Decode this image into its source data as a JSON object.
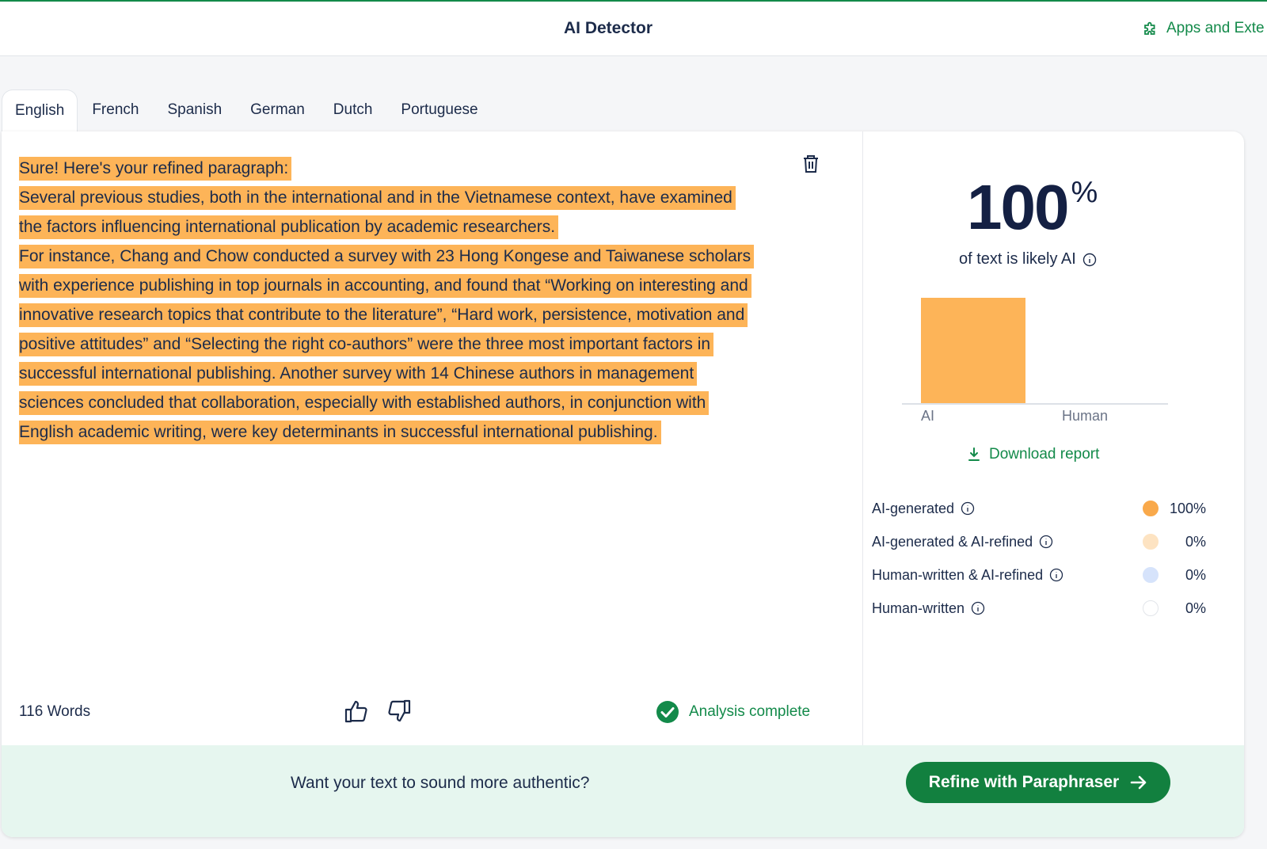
{
  "header": {
    "title": "AI Detector",
    "apps_link": "Apps and Exte"
  },
  "tabs": [
    {
      "label": "English",
      "active": true
    },
    {
      "label": "French",
      "active": false
    },
    {
      "label": "Spanish",
      "active": false
    },
    {
      "label": "German",
      "active": false
    },
    {
      "label": "Dutch",
      "active": false
    },
    {
      "label": "Portuguese",
      "active": false
    }
  ],
  "editor": {
    "lines": [
      "Sure! Here's your refined paragraph:",
      "Several previous studies, both in the international and in the Vietnamese context, have examined",
      "the factors influencing international publication by academic researchers.",
      "For instance, Chang and Chow conducted a survey with 23 Hong Kongese and Taiwanese scholars",
      "with experience publishing in top journals in accounting, and found that “Working on interesting and",
      "innovative research topics that contribute to the literature”, “Hard work, persistence, motivation and",
      "positive attitudes” and “Selecting the right co-authors” were the three most important factors in",
      "successful international publishing. Another survey with 14 Chinese authors in management",
      "sciences concluded that collaboration, especially with established authors, in conjunction with",
      "English academic writing, were key determinants in successful international publishing."
    ],
    "highlight_color": "#fdb458",
    "word_count": "116 Words",
    "status": "Analysis complete"
  },
  "results": {
    "score": "100",
    "score_unit": "%",
    "caption": "of text is likely AI",
    "download_label": "Download report",
    "breakdown": [
      {
        "label": "AI-generated",
        "value": "100%",
        "color": "#f9a94b"
      },
      {
        "label": "AI-generated & AI-refined",
        "value": "0%",
        "color": "#fde3c2"
      },
      {
        "label": "Human-written & AI-refined",
        "value": "0%",
        "color": "#d6e3fb"
      },
      {
        "label": "Human-written",
        "value": "0%",
        "color": "#ffffff"
      }
    ]
  },
  "chart_data": {
    "type": "bar",
    "categories": [
      "AI",
      "Human"
    ],
    "values": [
      100,
      0
    ],
    "ylim": [
      0,
      100
    ],
    "colors": [
      "#fdb458",
      "#fdb458"
    ]
  },
  "footer": {
    "prompt": "Want your text to sound more authentic?",
    "button_label": "Refine with Paraphraser"
  },
  "colors": {
    "accent": "#138a4a",
    "button": "#12803f",
    "footer_bg": "#e6f6ef"
  }
}
